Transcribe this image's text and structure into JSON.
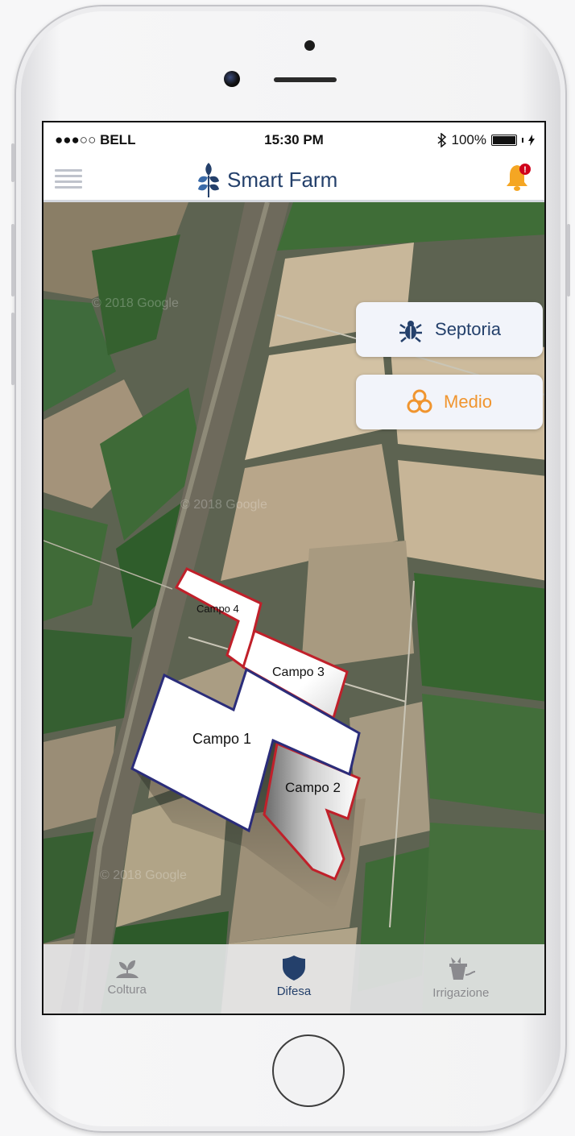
{
  "status_bar": {
    "carrier": "●●●○○ BELL",
    "time": "15:30 PM",
    "bluetooth_icon": "bluetooth-icon",
    "battery_percent": "100%",
    "charging_icon": "bolt-icon"
  },
  "navbar": {
    "title": "Smart Farm",
    "menu_icon": "hamburger-menu-icon",
    "logo_icon": "wheat-logo-icon",
    "notification_icon": "bell-icon",
    "notification_badge": "!"
  },
  "map": {
    "watermarks": [
      "© 2018 Google",
      "© 2018 Google",
      "© 2018 Google"
    ],
    "fields": [
      {
        "label": "Campo 1",
        "border_color": "#2b2d7a"
      },
      {
        "label": "Campo 2",
        "border_color": "#c0202a"
      },
      {
        "label": "Campo 3",
        "border_color": "#c0202a"
      },
      {
        "label": "Campo 4",
        "border_color": "#c0202a"
      }
    ]
  },
  "cards": {
    "disease": {
      "label": "Septoria",
      "icon": "bug-icon"
    },
    "risk": {
      "label": "Medio",
      "icon": "biohazard-icon"
    }
  },
  "tabbar": {
    "tabs": [
      {
        "label": "Coltura",
        "icon": "plant-icon",
        "active": false
      },
      {
        "label": "Difesa",
        "icon": "shield-icon",
        "active": true
      },
      {
        "label": "Irrigazione",
        "icon": "watering-pot-icon",
        "active": false
      }
    ]
  },
  "colors": {
    "brand_blue": "#24406b",
    "risk_orange": "#f0952f",
    "bell_orange": "#f5a623",
    "badge_red": "#d0021b",
    "inactive_gray": "#8a8a8e"
  }
}
